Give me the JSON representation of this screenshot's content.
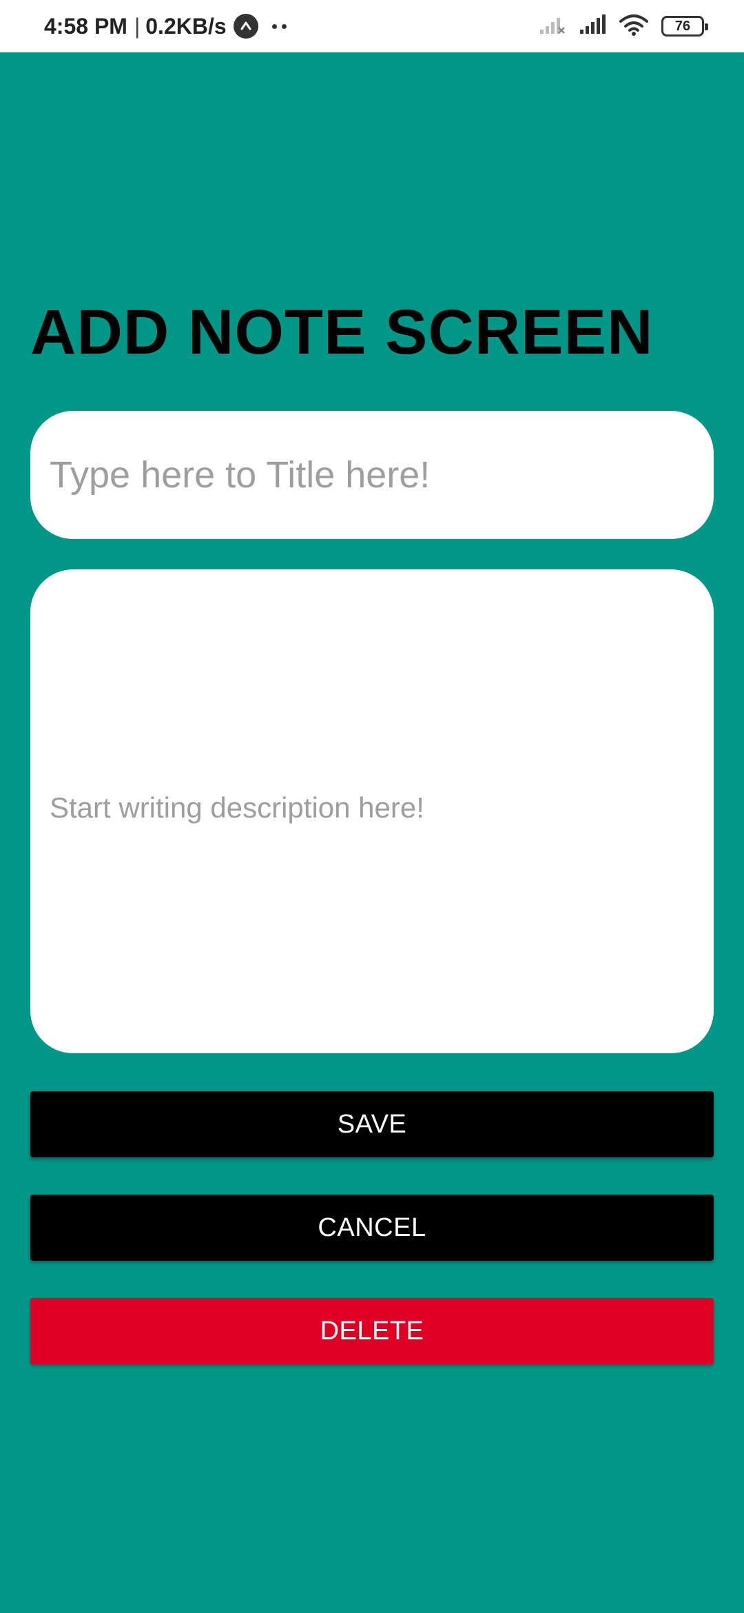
{
  "status_bar": {
    "time": "4:58 PM",
    "separator": "|",
    "network_speed": "0.2KB/s",
    "battery_level": "76",
    "icons": [
      "app-notification-icon",
      "more-dots-icon",
      "signal-off-icon",
      "signal-icon",
      "wifi-icon",
      "battery-icon"
    ]
  },
  "screen": {
    "title": "ADD NOTE SCREEN",
    "title_input": {
      "value": "",
      "placeholder": "Type here to Title here!"
    },
    "description_input": {
      "value": "",
      "placeholder": "Start writing description here!"
    },
    "buttons": {
      "save": "SAVE",
      "cancel": "CANCEL",
      "delete": "DELETE"
    }
  },
  "colors": {
    "background": "#009688",
    "primary_button": "#000000",
    "danger_button": "#e00024",
    "input_background": "#ffffff",
    "placeholder": "#9e9e9e"
  }
}
